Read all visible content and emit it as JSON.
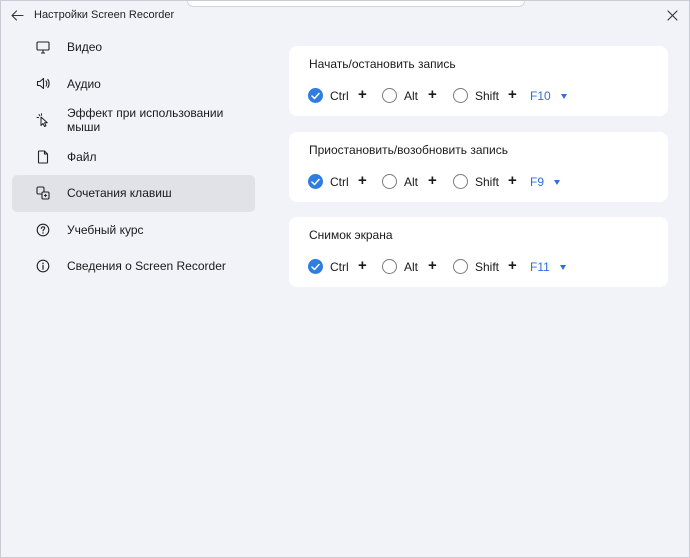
{
  "window": {
    "title": "Настройки Screen Recorder"
  },
  "sidebar": {
    "items": [
      {
        "label": "Видео",
        "icon": "monitor-icon"
      },
      {
        "label": "Аудио",
        "icon": "speaker-icon"
      },
      {
        "label": "Эффект при использовании мыши",
        "icon": "mouse-pointer-icon"
      },
      {
        "label": "Файл",
        "icon": "file-icon"
      },
      {
        "label": "Сочетания клавиш",
        "icon": "shortcut-icon",
        "active": true
      },
      {
        "label": "Учебный курс",
        "icon": "question-icon"
      },
      {
        "label": "Сведения о Screen Recorder",
        "icon": "info-icon"
      }
    ]
  },
  "shortcuts": [
    {
      "title": "Начать/остановить запись",
      "ctrl": {
        "label": "Ctrl",
        "checked": true
      },
      "alt": {
        "label": "Alt",
        "checked": false
      },
      "shift": {
        "label": "Shift",
        "checked": false
      },
      "key": "F10"
    },
    {
      "title": "Приостановить/возобновить запись",
      "ctrl": {
        "label": "Ctrl",
        "checked": true
      },
      "alt": {
        "label": "Alt",
        "checked": false
      },
      "shift": {
        "label": "Shift",
        "checked": false
      },
      "key": "F9"
    },
    {
      "title": "Снимок экрана",
      "ctrl": {
        "label": "Ctrl",
        "checked": true
      },
      "alt": {
        "label": "Alt",
        "checked": false
      },
      "shift": {
        "label": "Shift",
        "checked": false
      },
      "key": "F11"
    }
  ],
  "plus_sign": "+",
  "colors": {
    "accent": "#2f7de1",
    "link": "#2f6fd6",
    "background": "#f1f3f9",
    "card": "#ffffff",
    "active_nav": "#e0e2e8"
  }
}
